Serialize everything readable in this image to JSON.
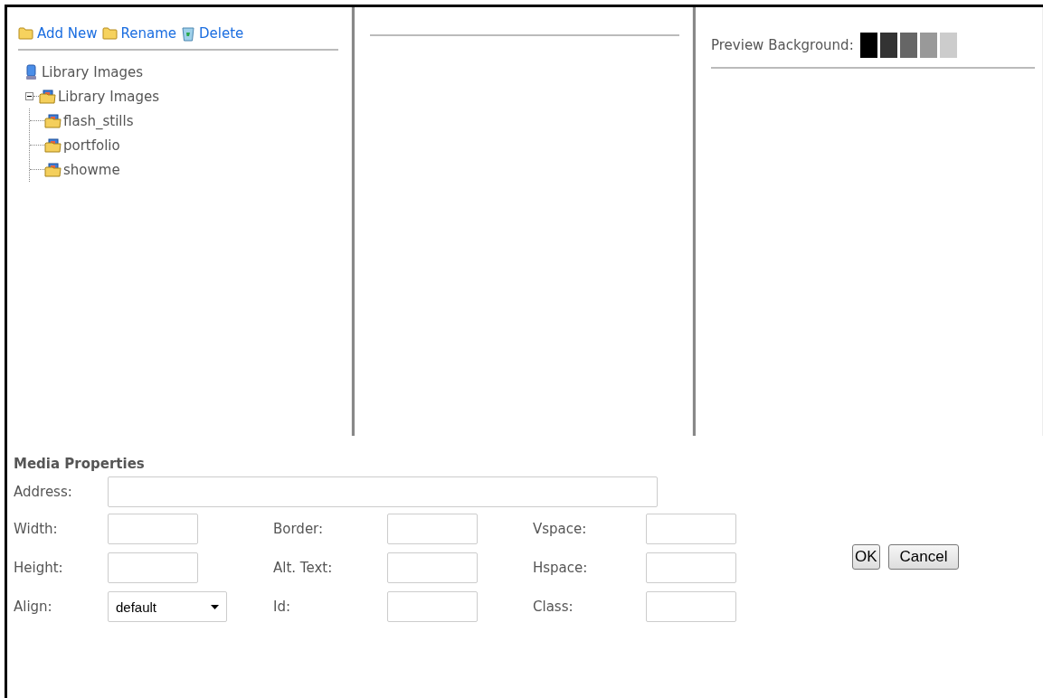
{
  "toolbar": [
    {
      "kind": "folder",
      "label": "Add New"
    },
    {
      "kind": "folder",
      "label": "Rename"
    },
    {
      "kind": "recycle",
      "label": "Delete"
    }
  ],
  "tree": [
    {
      "kind": "computer",
      "label": "Library Images",
      "children": [
        {
          "kind": "picture_folder",
          "label": "Library Images",
          "expanded": true,
          "children": [
            {
              "kind": "picture_folder",
              "label": "flash_stills"
            },
            {
              "kind": "picture_folder",
              "label": "portfolio"
            },
            {
              "kind": "picture_folder",
              "label": "showme"
            }
          ]
        }
      ]
    }
  ],
  "preview": {
    "label": "Preview Background:",
    "swatches": [
      {
        "color": "#000000"
      },
      {
        "color": "#333333"
      },
      {
        "color": "#666666"
      },
      {
        "color": "#999999"
      },
      {
        "color": "#cccccc"
      }
    ]
  },
  "media_properties": {
    "title": "Media Properties",
    "address": {
      "label": "Address:"
    },
    "rows": [
      [
        {
          "label": "Width:",
          "kind": "text"
        },
        {
          "label": "Border:",
          "kind": "text"
        },
        {
          "label": "Vspace:",
          "kind": "text"
        }
      ],
      [
        {
          "label": "Height:",
          "kind": "text"
        },
        {
          "label": "Alt. Text:",
          "kind": "text"
        },
        {
          "label": "Hspace:",
          "kind": "text"
        }
      ],
      [
        {
          "label": "Align:",
          "kind": "select",
          "value": "default"
        },
        {
          "label": "Id:",
          "kind": "text"
        },
        {
          "label": "Class:",
          "kind": "text"
        }
      ]
    ]
  },
  "buttons": [
    "OK",
    "Cancel"
  ]
}
